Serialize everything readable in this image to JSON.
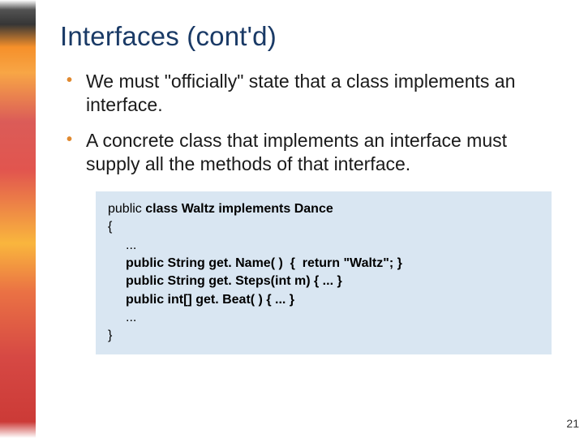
{
  "title": "Interfaces (cont'd)",
  "bullets": [
    "We must \"officially\" state that a class implements an interface.",
    "A concrete class that implements an interface must supply all the methods of that interface."
  ],
  "code": {
    "l1_pre": "public ",
    "l1_bold": "class Waltz implements Dance",
    "l2": "{",
    "l3": "...",
    "l4": "public String get. Name( )  {  return \"Waltz\"; }",
    "l5": "public String get. Steps(int m) { ... }",
    "l6": "public int[] get. Beat( ) { ... }",
    "l7": "...",
    "l8": "}"
  },
  "page_number": "21"
}
